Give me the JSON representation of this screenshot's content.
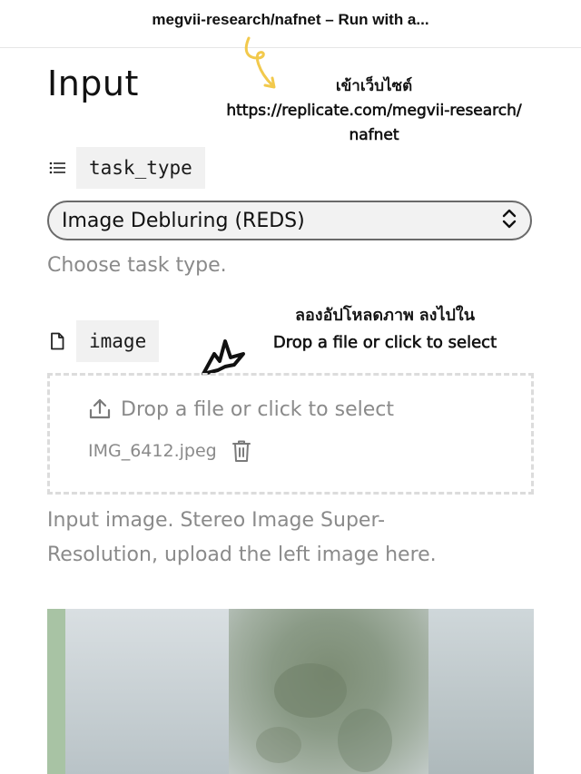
{
  "topbar": {
    "title": "megvii-research/nafnet – Run with a..."
  },
  "section": {
    "title": "Input"
  },
  "annotations": {
    "website_note_th": "เข้าเว็บไซต์",
    "website_url": "https://replicate.com/megvii-research/",
    "website_url_tail": "nafnet",
    "upload_note_th": "ลองอัปโหลดภาพ ลงไปใน",
    "upload_note_en": "Drop a file or click to select"
  },
  "task_type": {
    "label": "task_type",
    "icon": "list-icon",
    "selected": "Image Debluring (REDS)",
    "help": "Choose task type."
  },
  "image": {
    "label": "image",
    "icon": "file-icon",
    "drop_text": "Drop a file or click to select",
    "file_name": "IMG_6412.jpeg",
    "help_line1": "Input image. Stereo Image Super-",
    "help_line2": "Resolution, upload the left image here."
  },
  "colors": {
    "annotation_arrow": "#f2c94c",
    "helper_text": "#8a8a8a"
  }
}
